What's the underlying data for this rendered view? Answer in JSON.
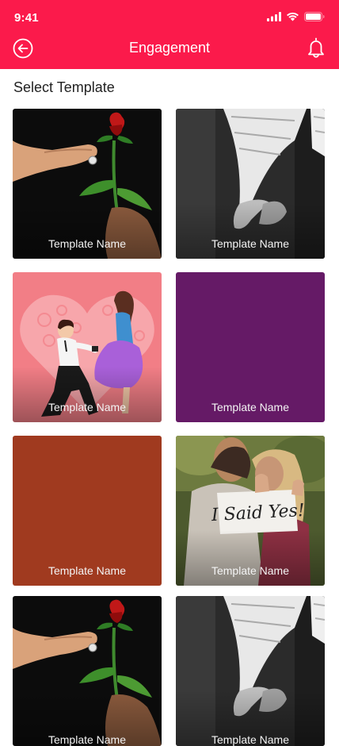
{
  "status_bar": {
    "time": "9:41"
  },
  "header": {
    "title": "Engagement",
    "back_icon": "back-arrow-circle-icon",
    "notification_icon": "bell-icon",
    "color": "#fb1a4b"
  },
  "content": {
    "section_title": "Select Template"
  },
  "templates": [
    {
      "label": "Template Name",
      "style": "rose-hand-photo"
    },
    {
      "label": "Template Name",
      "style": "holding-hands-bw-photo"
    },
    {
      "label": "Template Name",
      "style": "proposal-illustration"
    },
    {
      "label": "Template Name",
      "style": "solid",
      "color": "#651a66"
    },
    {
      "label": "Template Name",
      "style": "solid",
      "color": "#a03a1f"
    },
    {
      "label": "Template Name",
      "style": "i-said-yes-photo"
    },
    {
      "label": "Template Name",
      "style": "rose-hand-photo"
    },
    {
      "label": "Template Name",
      "style": "holding-hands-bw-photo"
    }
  ],
  "photo_text": {
    "sign": "I Said Yes!"
  }
}
